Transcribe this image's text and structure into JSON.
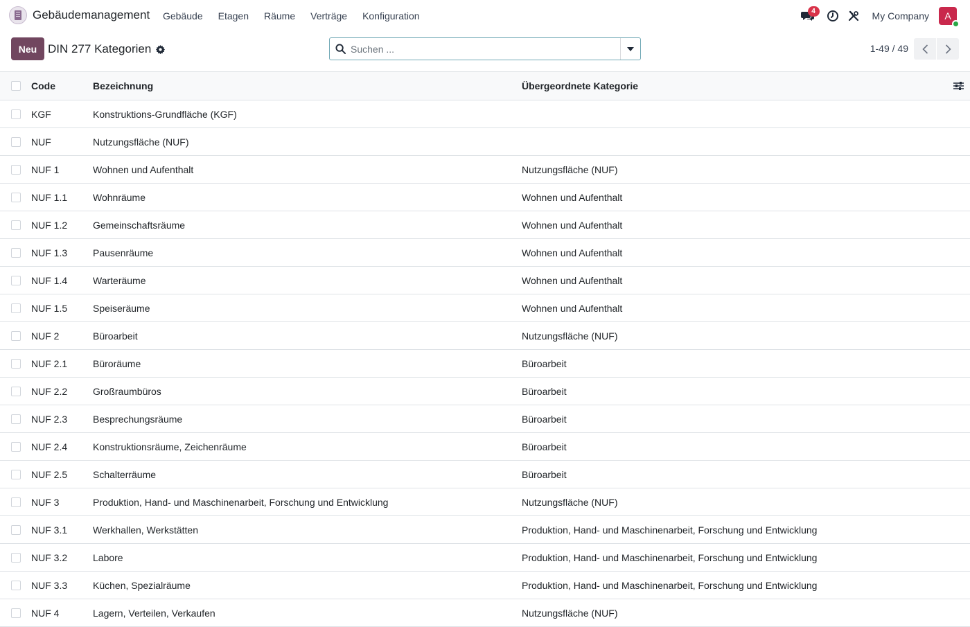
{
  "navbar": {
    "app_name": "Gebäudemanagement",
    "menu": [
      "Gebäude",
      "Etagen",
      "Räume",
      "Verträge",
      "Konfiguration"
    ],
    "messages_badge": "4",
    "company": "My Company",
    "avatar_initial": "A"
  },
  "control": {
    "new_label": "Neu",
    "title": "DIN 277 Kategorien",
    "search_placeholder": "Suchen ...",
    "pager": "1-49 / 49"
  },
  "table": {
    "headers": {
      "code": "Code",
      "name": "Bezeichnung",
      "parent": "Übergeordnete Kategorie"
    },
    "rows": [
      {
        "code": "KGF",
        "name": "Konstruktions-Grundfläche (KGF)",
        "parent": ""
      },
      {
        "code": "NUF",
        "name": "Nutzungsfläche (NUF)",
        "parent": ""
      },
      {
        "code": "NUF 1",
        "name": "Wohnen und Aufenthalt",
        "parent": "Nutzungsfläche (NUF)"
      },
      {
        "code": "NUF 1.1",
        "name": "Wohnräume",
        "parent": "Wohnen und Aufenthalt"
      },
      {
        "code": "NUF 1.2",
        "name": "Gemeinschaftsräume",
        "parent": "Wohnen und Aufenthalt"
      },
      {
        "code": "NUF 1.3",
        "name": "Pausenräume",
        "parent": "Wohnen und Aufenthalt"
      },
      {
        "code": "NUF 1.4",
        "name": "Warteräume",
        "parent": "Wohnen und Aufenthalt"
      },
      {
        "code": "NUF 1.5",
        "name": "Speiseräume",
        "parent": "Wohnen und Aufenthalt"
      },
      {
        "code": "NUF 2",
        "name": "Büroarbeit",
        "parent": "Nutzungsfläche (NUF)"
      },
      {
        "code": "NUF 2.1",
        "name": "Büroräume",
        "parent": "Büroarbeit"
      },
      {
        "code": "NUF 2.2",
        "name": "Großraumbüros",
        "parent": "Büroarbeit"
      },
      {
        "code": "NUF 2.3",
        "name": "Besprechungsräume",
        "parent": "Büroarbeit"
      },
      {
        "code": "NUF 2.4",
        "name": "Konstruktionsräume, Zeichenräume",
        "parent": "Büroarbeit"
      },
      {
        "code": "NUF 2.5",
        "name": "Schalterräume",
        "parent": "Büroarbeit"
      },
      {
        "code": "NUF 3",
        "name": "Produktion, Hand- und Maschinenarbeit, Forschung und Entwicklung",
        "parent": "Nutzungsfläche (NUF)"
      },
      {
        "code": "NUF 3.1",
        "name": "Werkhallen, Werkstätten",
        "parent": "Produktion, Hand- und Maschinenarbeit, Forschung und Entwicklung"
      },
      {
        "code": "NUF 3.2",
        "name": "Labore",
        "parent": "Produktion, Hand- und Maschinenarbeit, Forschung und Entwicklung"
      },
      {
        "code": "NUF 3.3",
        "name": "Küchen, Spezialräume",
        "parent": "Produktion, Hand- und Maschinenarbeit, Forschung und Entwicklung"
      },
      {
        "code": "NUF 4",
        "name": "Lagern, Verteilen, Verkaufen",
        "parent": "Nutzungsfläche (NUF)"
      }
    ]
  },
  "colors": {
    "primary": "#71465f",
    "badge": "#d9334a",
    "avatar": "#c9284c",
    "online": "#28a745",
    "search_border": "#71a9b6"
  },
  "icons": {
    "app_logo": "building-icon",
    "messages": "chat-icon",
    "activity": "clock-icon",
    "tools": "tools-icon",
    "settings": "gear-icon",
    "search": "search-icon",
    "dropdown": "caret-down-icon",
    "prev": "chevron-left-icon",
    "next": "chevron-right-icon",
    "columns": "sliders-icon"
  }
}
